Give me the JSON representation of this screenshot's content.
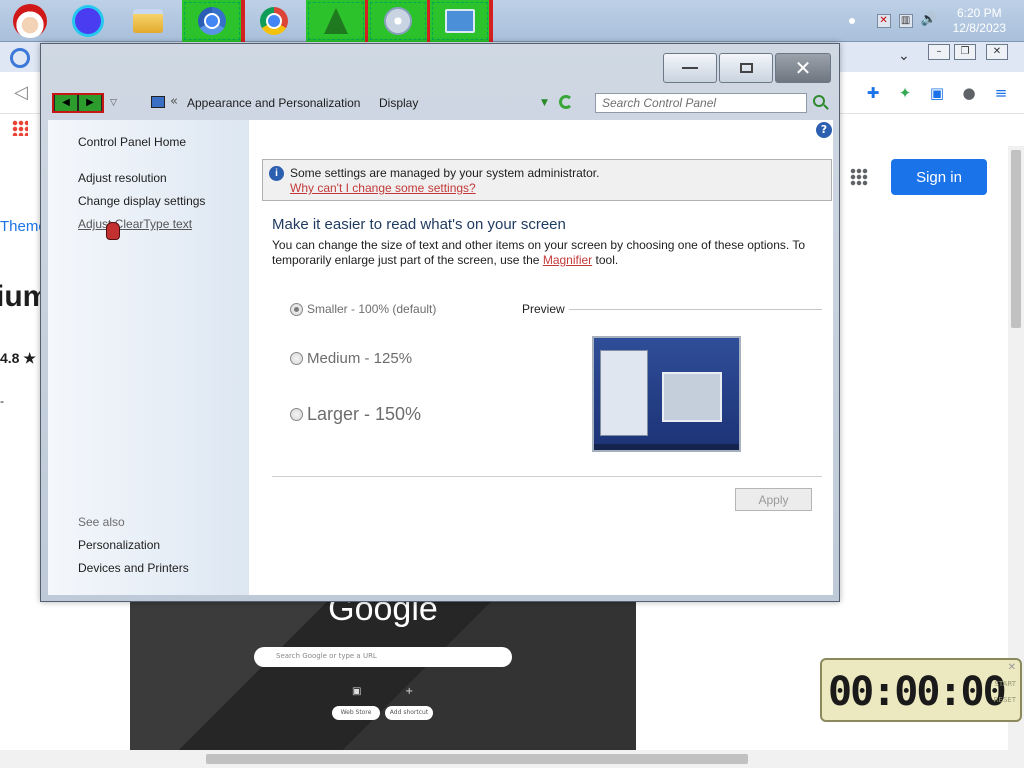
{
  "taskbar": {
    "apps": [
      {
        "icon": "santa-icon"
      },
      {
        "icon": "circle-app-icon"
      },
      {
        "icon": "folder-icon"
      },
      {
        "icon": "chromium-icon"
      },
      {
        "icon": "chrome-icon"
      },
      {
        "icon": "christmas-tree-icon"
      },
      {
        "icon": "disc-tool-icon"
      },
      {
        "icon": "control-panel-icon"
      }
    ],
    "clock": {
      "time": "6:20 PM",
      "date": "12/8/2023"
    }
  },
  "browser": {
    "left_texts": {
      "themes": "Theme",
      "title": "ium",
      "rating": "4.8 ★",
      "dash": "-"
    },
    "sign_in_label": "Sign in",
    "ntp": {
      "logo": "Google",
      "search_placeholder": "Search Google or type a URL",
      "shortcut_1": "Web Store",
      "shortcut_2": "Add shortcut"
    }
  },
  "timer": {
    "display": "00:00:00",
    "start_label": "START",
    "reset_label": "RESET"
  },
  "control_panel": {
    "breadcrumb": {
      "sep": "«",
      "item1": "Appearance and Personalization",
      "item2": "Display"
    },
    "search_placeholder": "Search Control Panel",
    "sidebar": {
      "home": "Control Panel Home",
      "links": [
        "Adjust resolution",
        "Change display settings",
        "Adjust ClearType text"
      ],
      "see_also_label": "See also",
      "see_also": [
        "Personalization",
        "Devices and Printers"
      ]
    },
    "info": {
      "text": "Some settings are managed by your system administrator.",
      "link": "Why can't I change some settings?"
    },
    "heading": "Make it easier to read what's on your screen",
    "description_before": "You can change the size of text and other items on your screen by choosing one of these options. To temporarily enlarge just part of the screen, use the",
    "description_link": "Magnifier",
    "description_after": " tool.",
    "options": [
      {
        "label": "Smaller - 100% (default)",
        "selected": true
      },
      {
        "label": "Medium - 125%",
        "selected": false
      },
      {
        "label": "Larger - 150%",
        "selected": false
      }
    ],
    "preview_label": "Preview",
    "apply_label": "Apply",
    "help_glyph": "?",
    "info_glyph": "i"
  }
}
